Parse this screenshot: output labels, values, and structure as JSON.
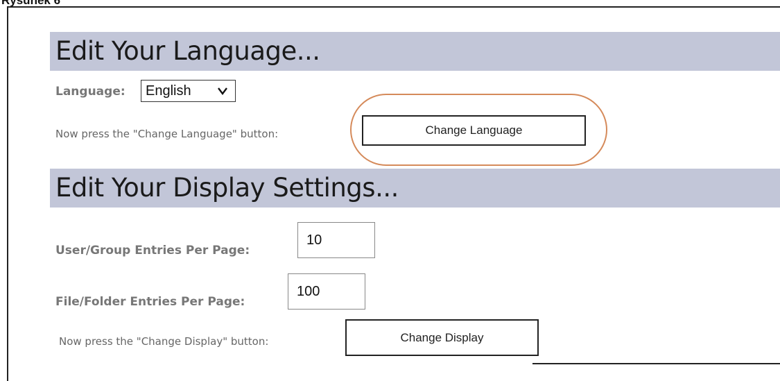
{
  "caption": "Rysunek 6",
  "language_section": {
    "title": "Edit Your Language...",
    "language_label": "Language:",
    "language_select": {
      "selected": "English"
    },
    "instruction": "Now press the \"Change Language\" button:",
    "button_label": "Change Language"
  },
  "display_section": {
    "title": "Edit Your Display Settings...",
    "user_group_label": "User/Group Entries Per Page:",
    "user_group_value": "10",
    "file_folder_label": "File/Folder Entries Per Page:",
    "file_folder_value": "100",
    "instruction": "Now press the \"Change Display\" button:",
    "button_label": "Change Display"
  },
  "colors": {
    "section_header_bg": "#c2c6d8",
    "highlight_ring": "#d58a5a",
    "label_text": "#777777"
  },
  "icons": {
    "dropdown": "chevron-down-icon"
  }
}
